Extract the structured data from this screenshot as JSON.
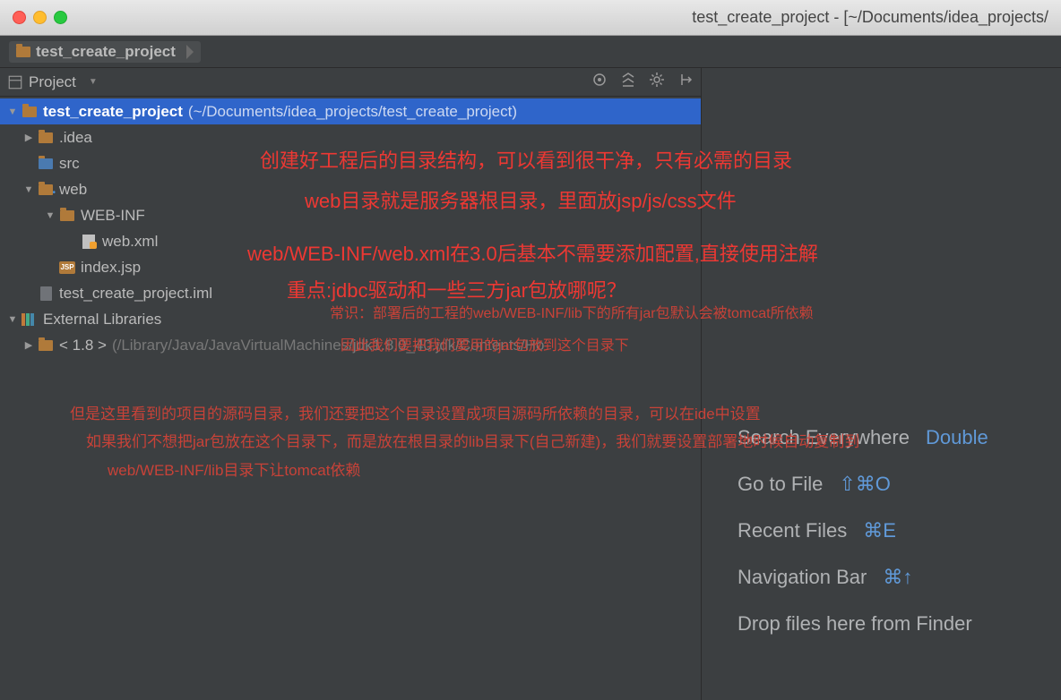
{
  "window": {
    "title": "test_create_project - [~/Documents/idea_projects/"
  },
  "breadcrumb": {
    "root": "test_create_project"
  },
  "panel": {
    "title": "Project"
  },
  "tree": {
    "root": {
      "name": "test_create_project",
      "path": "(~/Documents/idea_projects/test_create_project)"
    },
    "idea": ".idea",
    "src": "src",
    "web": "web",
    "webinf": "WEB-INF",
    "webxml": "web.xml",
    "indexjsp": "index.jsp",
    "iml": "test_create_project.iml",
    "extlib": "External Libraries",
    "jdk": {
      "name": "< 1.8 >",
      "path": "(/Library/Java/JavaVirtualMachines/jdk1.8.0_40.jdk/Contents/Ho"
    }
  },
  "hints": {
    "search": {
      "label": "Search Everywhere",
      "key": "Double"
    },
    "gotofile": {
      "label": "Go to File",
      "key": "⇧⌘O"
    },
    "recent": {
      "label": "Recent Files",
      "key": "⌘E"
    },
    "navbar": {
      "label": "Navigation Bar",
      "key": "⌘↑"
    },
    "drop": {
      "label": "Drop files here from Finder"
    }
  },
  "annotations": {
    "a1": "创建好工程后的目录结构，可以看到很干净，只有必需的目录",
    "a2": "web目录就是服务器根目录，里面放jsp/js/css文件",
    "a3": "web/WEB-INF/web.xml在3.0后基本不需要添加配置,直接使用注解",
    "a4": "重点:jdbc驱动和一些三方jar包放哪呢？",
    "a5": "常识：部署后的工程的web/WEB-INF/lib下的所有jar包默认会被tomcat所依赖",
    "a6": "因此我们要把我们要用的jar包放到这个目录下",
    "a7": "但是这里看到的项目的源码目录，我们还要把这个目录设置成项目源码所依赖的目录，可以在ide中设置",
    "a8": "如果我们不想把jar包放在这个目录下，而是放在根目录的lib目录下(自己新建)，我们就要设置部署地时候自动复制到",
    "a9": "web/WEB-INF/lib目录下让tomcat依赖"
  }
}
